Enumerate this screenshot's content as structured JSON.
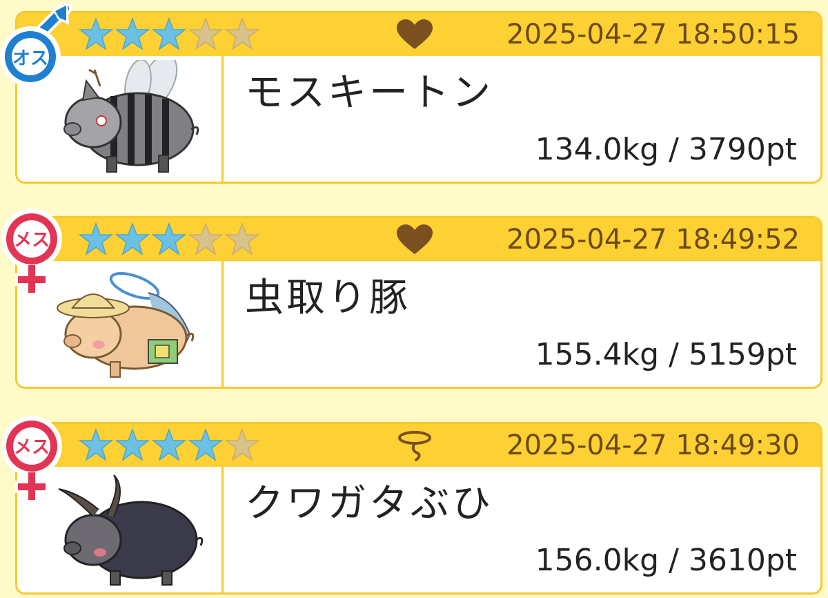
{
  "colors": {
    "background": "#fffbc8",
    "header": "#fdd033",
    "border": "#f6c92f",
    "star_filled": "#6cc0e4",
    "star_empty": "#d9c18a",
    "timestamp": "#6b4a17",
    "male": "#1f7fd1",
    "female": "#e23454"
  },
  "entries": [
    {
      "gender_label": "オス",
      "gender": "male",
      "stars_filled": 3,
      "stars_total": 5,
      "status_icon": "heart-icon",
      "timestamp": "2025-04-27 18:50:15",
      "portrait": "mosquito-pig-illustration",
      "name": "モスキートン",
      "stats": "134.0kg / 3790pt"
    },
    {
      "gender_label": "メス",
      "gender": "female",
      "stars_filled": 3,
      "stars_total": 5,
      "status_icon": "heart-icon",
      "timestamp": "2025-04-27 18:49:52",
      "portrait": "bug-catcher-pig-illustration",
      "name": "虫取り豚",
      "stats": "155.4kg / 5159pt"
    },
    {
      "gender_label": "メス",
      "gender": "female",
      "stars_filled": 4,
      "stars_total": 5,
      "status_icon": "lasso-icon",
      "timestamp": "2025-04-27 18:49:30",
      "portrait": "stag-beetle-pig-illustration",
      "name": "クワガタぶひ",
      "stats": "156.0kg / 3610pt"
    }
  ]
}
